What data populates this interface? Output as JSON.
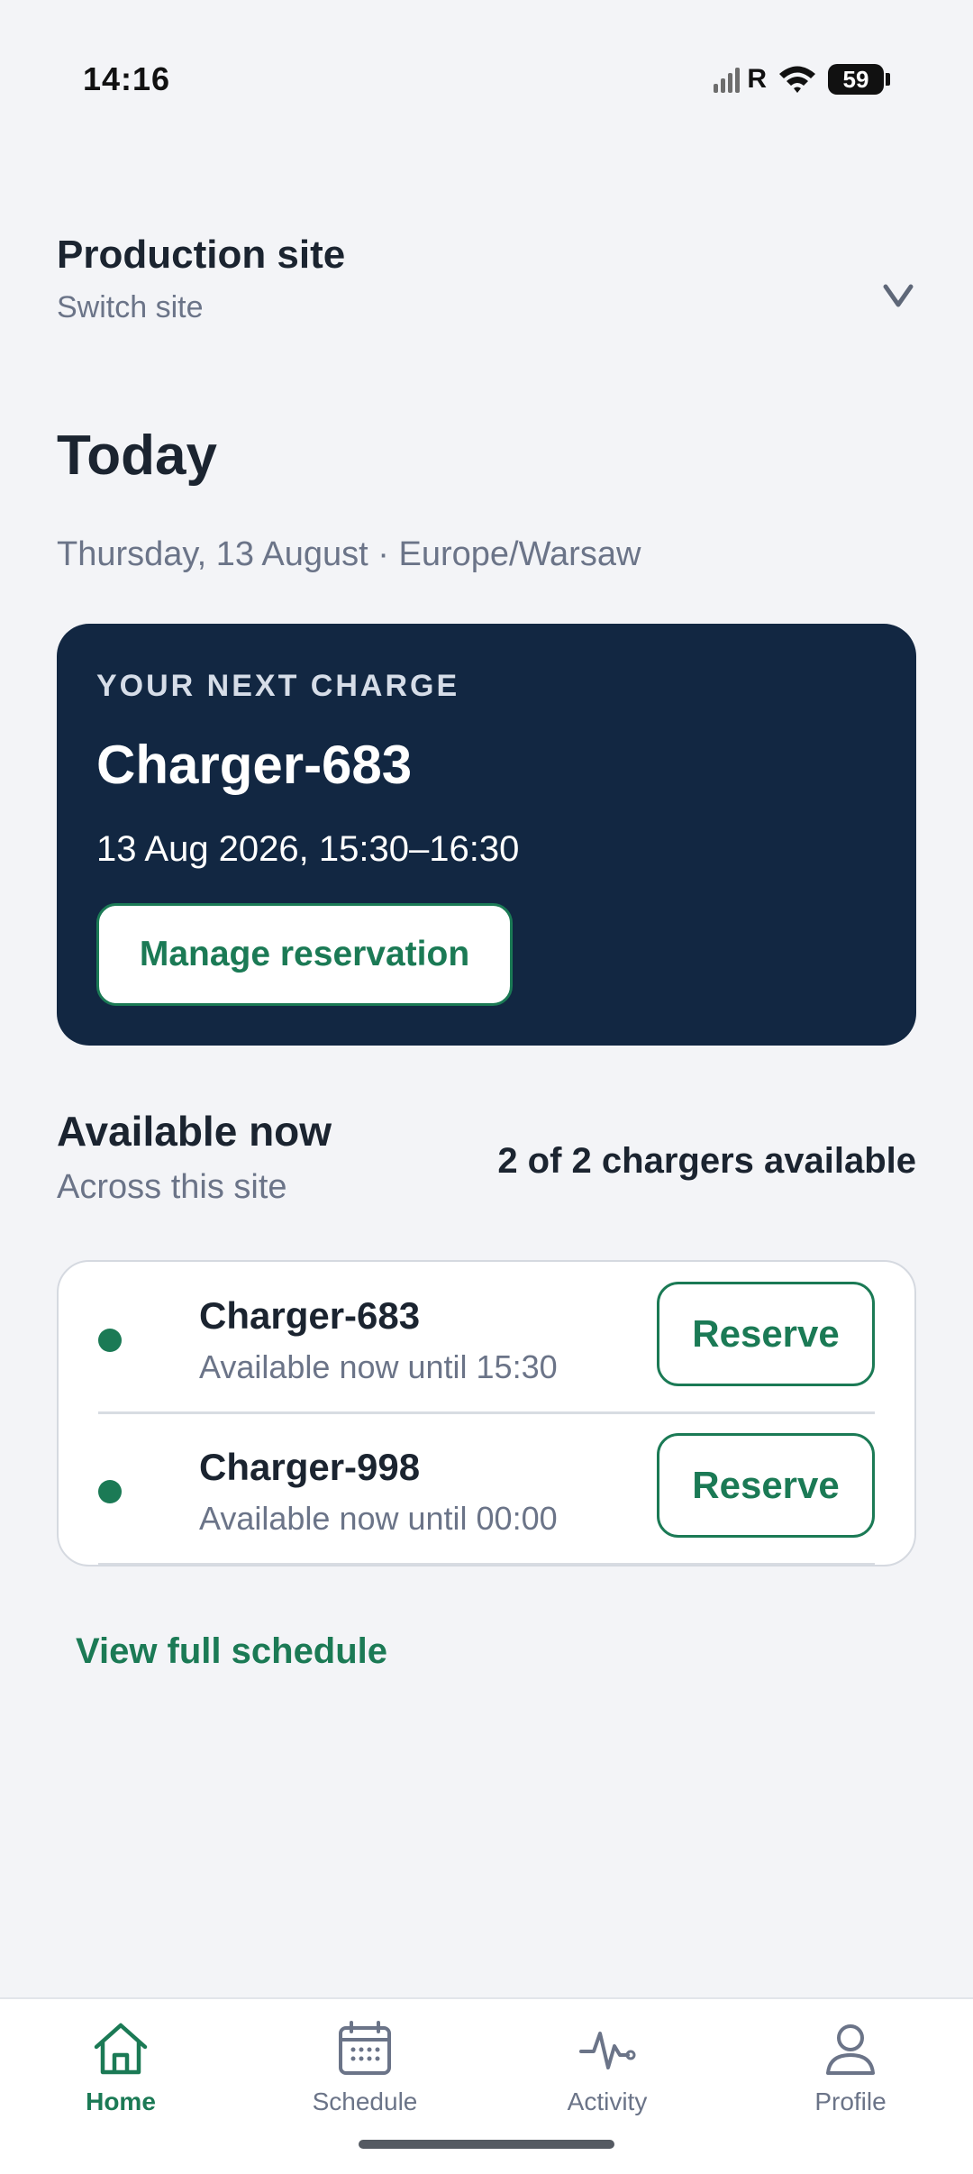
{
  "status_bar": {
    "time": "14:16",
    "roaming": "R",
    "battery": "59",
    "icons": [
      "signal-icon",
      "wifi-icon",
      "battery-icon"
    ]
  },
  "site": {
    "title": "Production site",
    "switch_label": "Switch site",
    "chevron_icon": "chevron-down-icon"
  },
  "today": {
    "heading": "Today",
    "date_line": "Thursday, 13 August · Europe/Warsaw"
  },
  "next_charge": {
    "label": "YOUR NEXT CHARGE",
    "charger": "Charger-683",
    "time": "13 Aug 2026, 15:30–16:30",
    "manage_label": "Manage reservation"
  },
  "available": {
    "title": "Available now",
    "subtitle": "Across this site",
    "count_text": "2 of 2 chargers available",
    "chargers": [
      {
        "name": "Charger-683",
        "status": "Available now until 15:30",
        "action": "Reserve"
      },
      {
        "name": "Charger-998",
        "status": "Available now until 00:00",
        "action": "Reserve"
      }
    ]
  },
  "view_schedule_label": "View full schedule",
  "bottom_nav": {
    "items": [
      {
        "label": "Home",
        "icon": "home-icon",
        "active": true
      },
      {
        "label": "Schedule",
        "icon": "calendar-icon",
        "active": false
      },
      {
        "label": "Activity",
        "icon": "activity-icon",
        "active": false
      },
      {
        "label": "Profile",
        "icon": "profile-icon",
        "active": false
      }
    ]
  },
  "colors": {
    "background": "#f3f4f7",
    "card_dark": "#122742",
    "accent_green": "#1b7a55",
    "text_primary": "#1b2430",
    "text_secondary": "#6b7488"
  }
}
